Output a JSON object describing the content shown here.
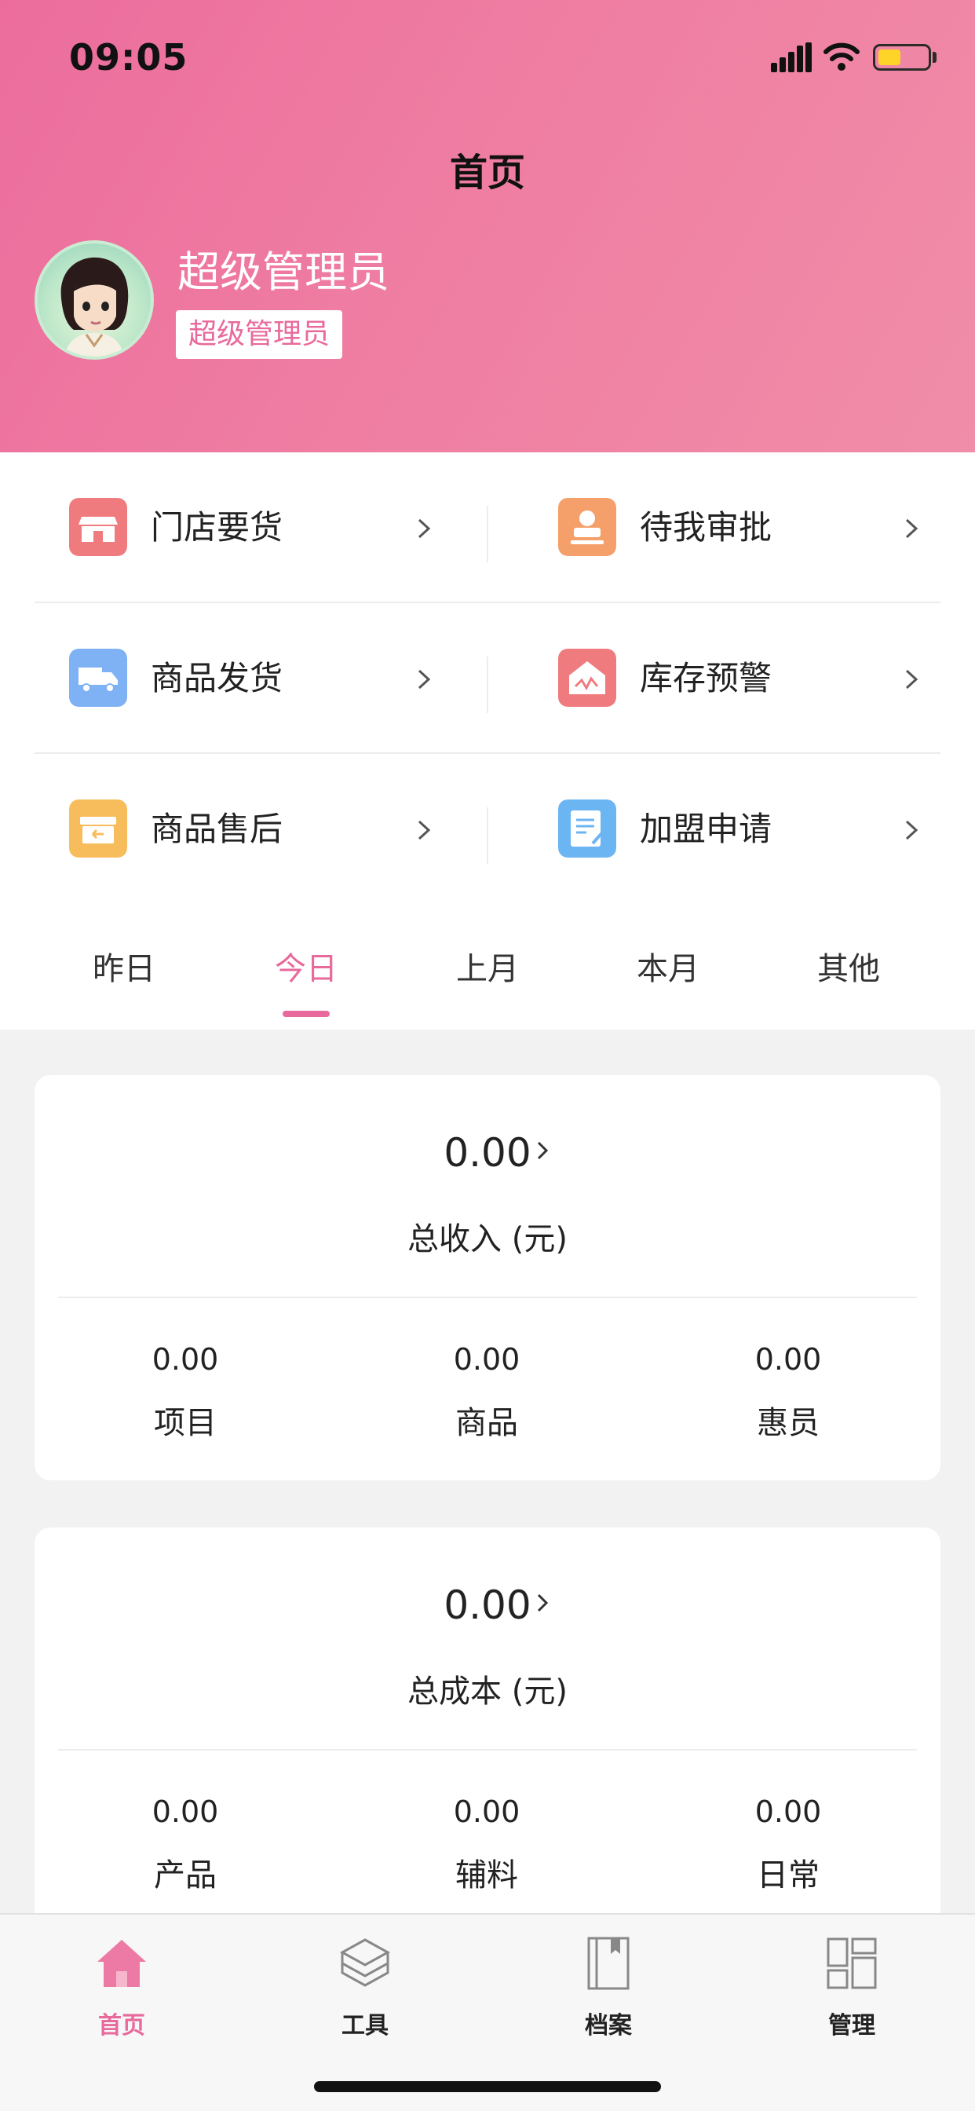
{
  "status_bar": {
    "time": "09:05"
  },
  "header": {
    "title": "首页",
    "user_name": "超级管理员",
    "role_badge": "超级管理员"
  },
  "menu": {
    "items": [
      {
        "label": "门店要货",
        "icon": "store-icon",
        "color": "#ef7b7e"
      },
      {
        "label": "待我审批",
        "icon": "stamp-icon",
        "color": "#f5a06a"
      },
      {
        "label": "商品发货",
        "icon": "truck-icon",
        "color": "#7fb2f5"
      },
      {
        "label": "库存预警",
        "icon": "warehouse-alert-icon",
        "color": "#ef7b7e"
      },
      {
        "label": "商品售后",
        "icon": "return-box-icon",
        "color": "#f7bd5c"
      },
      {
        "label": "加盟申请",
        "icon": "form-edit-icon",
        "color": "#6cb5f3"
      }
    ]
  },
  "periods": {
    "tabs": [
      "昨日",
      "今日",
      "上月",
      "本月",
      "其他"
    ],
    "active_index": 1
  },
  "cards": [
    {
      "total": "0.00",
      "label": "总收入 (元)",
      "subs": [
        {
          "value": "0.00",
          "label": "项目"
        },
        {
          "value": "0.00",
          "label": "商品"
        },
        {
          "value": "0.00",
          "label": "惠员"
        }
      ]
    },
    {
      "total": "0.00",
      "label": "总成本 (元)",
      "subs": [
        {
          "value": "0.00",
          "label": "产品"
        },
        {
          "value": "0.00",
          "label": "辅料"
        },
        {
          "value": "0.00",
          "label": "日常"
        }
      ]
    }
  ],
  "tabbar": {
    "items": [
      {
        "label": "首页",
        "icon": "home-icon"
      },
      {
        "label": "工具",
        "icon": "layers-icon"
      },
      {
        "label": "档案",
        "icon": "book-icon"
      },
      {
        "label": "管理",
        "icon": "dashboard-icon"
      }
    ],
    "active_index": 0,
    "accent": "#e8699b"
  }
}
